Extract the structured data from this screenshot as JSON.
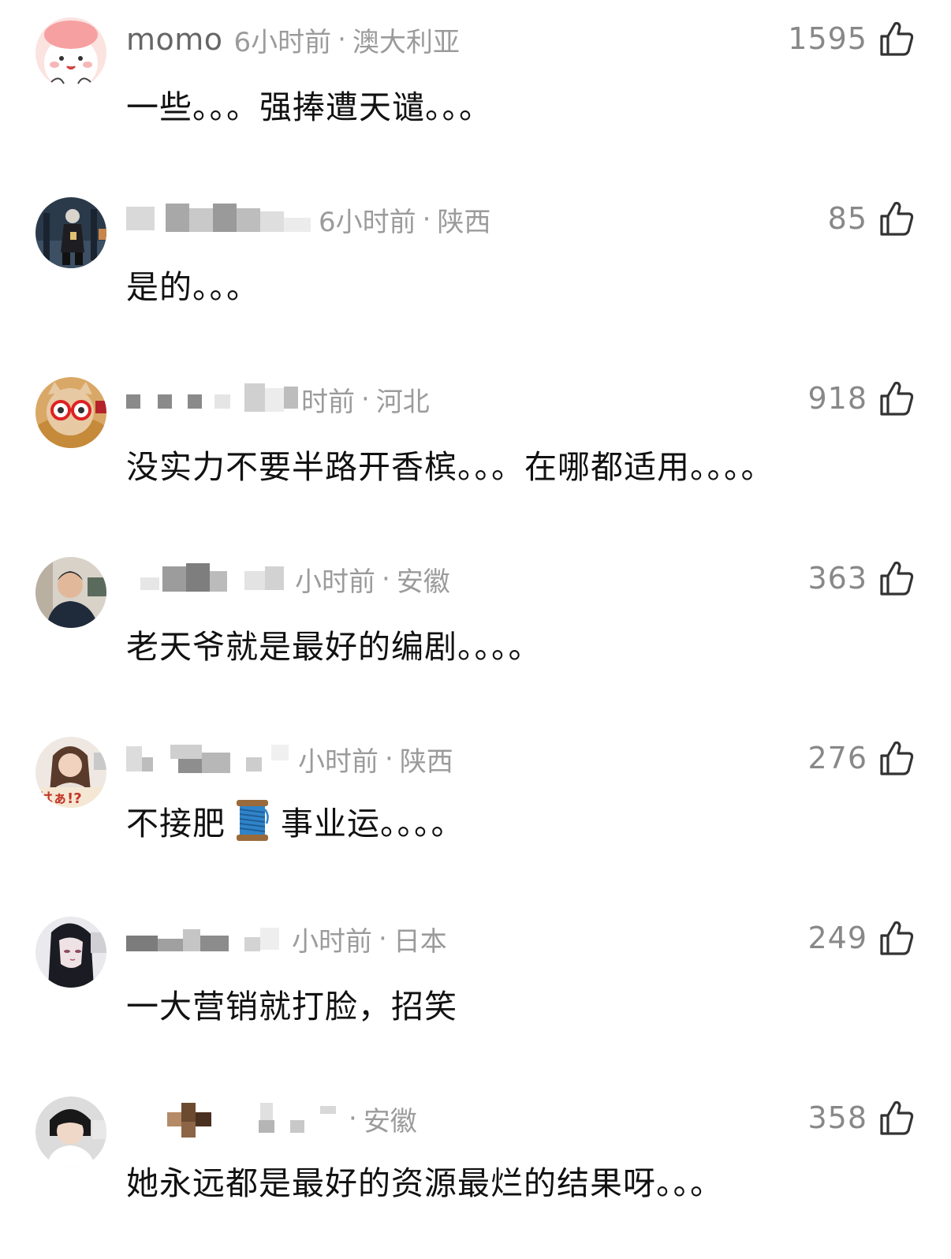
{
  "comments": [
    {
      "username": "momo",
      "time": "6小时前",
      "location": "澳大利亚",
      "likes": "1595",
      "text": "一些。。。强捧遭天谴。。。",
      "avatar": "pink-cartoon-avatar"
    },
    {
      "username": "",
      "time": "6小时前",
      "location": "陕西",
      "likes": "85",
      "text": "是的。。。",
      "avatar": "game-character-avatar"
    },
    {
      "username": "",
      "time": "时前",
      "location": "河北",
      "likes": "918",
      "text": "没实力不要半路开香槟。。。在哪都适用。。。。",
      "avatar": "cat-with-glasses-avatar"
    },
    {
      "username": "",
      "time": "小时前",
      "location": "安徽",
      "likes": "363",
      "text": "老天爷就是最好的编剧。。。。",
      "avatar": "man-photo-avatar"
    },
    {
      "username": "",
      "time": "小时前",
      "location": "陕西",
      "likes": "276",
      "text_before": "不接肥",
      "text_after": "事业运。。。。",
      "emoji": "spool-of-thread",
      "avatar": "girl-photo-avatar"
    },
    {
      "username": "",
      "time": "小时前",
      "location": "日本",
      "likes": "249",
      "text": "一大营销就打脸，招笑",
      "avatar": "anime-girl-avatar"
    },
    {
      "username": "",
      "time": "",
      "location": "安徽",
      "likes": "358",
      "text": "她永远都是最好的资源最烂的结果呀。。。",
      "avatar": "boy-photo-avatar"
    }
  ],
  "separator": "·",
  "colors": {
    "meta": "#9b9b9b",
    "username": "#666666",
    "likes": "#888888",
    "text": "#111111"
  }
}
